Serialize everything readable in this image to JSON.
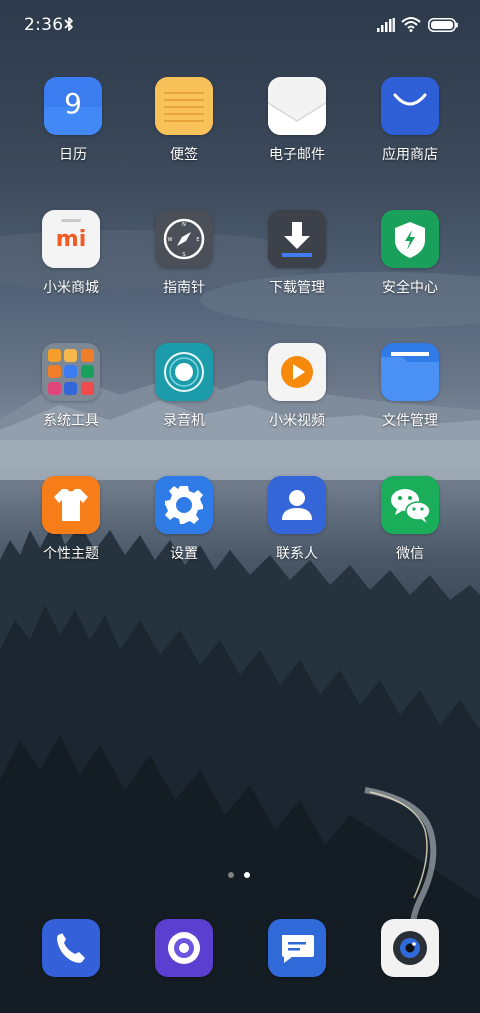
{
  "status_bar": {
    "time": "2:36",
    "icons": [
      "bluetooth-icon",
      "signal-icon",
      "wifi-icon",
      "battery-icon"
    ]
  },
  "apps": [
    {
      "label": "日历",
      "icon": "calendar-icon",
      "badge_text": "9",
      "color": "#3b7df0"
    },
    {
      "label": "便签",
      "icon": "notes-icon",
      "color": "#f7b84b"
    },
    {
      "label": "电子邮件",
      "icon": "email-icon",
      "color": "#f2f2f2"
    },
    {
      "label": "应用商店",
      "icon": "app-store-icon",
      "color": "#3060d8"
    },
    {
      "label": "小米商城",
      "icon": "mi-store-icon",
      "logo_text": "mi",
      "color": "#f4f4f4"
    },
    {
      "label": "指南针",
      "icon": "compass-icon",
      "color": "#4a4f57"
    },
    {
      "label": "下载管理",
      "icon": "download-icon",
      "color": "#3c4048"
    },
    {
      "label": "安全中心",
      "icon": "security-icon",
      "color": "#1aa05a"
    },
    {
      "label": "系统工具",
      "icon": "folder-icon",
      "color": "#5d6a78"
    },
    {
      "label": "录音机",
      "icon": "recorder-icon",
      "color": "#1f9aa8"
    },
    {
      "label": "小米视频",
      "icon": "video-icon",
      "color": "#f4f4f4"
    },
    {
      "label": "文件管理",
      "icon": "file-manager-icon",
      "color": "#2f7be8"
    },
    {
      "label": "个性主题",
      "icon": "themes-icon",
      "color": "#f77e1a"
    },
    {
      "label": "设置",
      "icon": "settings-icon",
      "color": "#2f7be8"
    },
    {
      "label": "联系人",
      "icon": "contacts-icon",
      "color": "#3466d8"
    },
    {
      "label": "微信",
      "icon": "wechat-icon",
      "color": "#1aad5a"
    }
  ],
  "page_indicator": {
    "pages": 2,
    "current": 2
  },
  "dock": [
    {
      "icon": "phone-icon",
      "color": "#3461d9"
    },
    {
      "icon": "browser-icon",
      "color": "#5a3fd0"
    },
    {
      "icon": "messages-icon",
      "color": "#2f6ad8"
    },
    {
      "icon": "camera-icon",
      "color": "#f2f2f2"
    }
  ]
}
